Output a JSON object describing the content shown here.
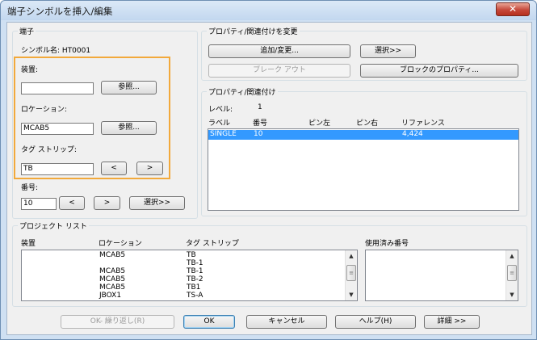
{
  "window": {
    "title": "端子シンボルを挿入/編集",
    "close_glyph": "✕"
  },
  "terminal": {
    "legend": "端子",
    "symbol_name_label": "シンボル名: HT0001",
    "device_label": "装置:",
    "device_value": "",
    "browse_label": "参照...",
    "location_label": "ロケーション:",
    "location_value": "MCAB5",
    "strip_label": "タグ ストリップ:",
    "strip_value": "TB",
    "prev_label": "<",
    "next_label": ">",
    "number_label": "番号:",
    "number_value": "10",
    "select_label": "選択>>"
  },
  "props_change": {
    "legend": "プロパティ/関連付けを変更",
    "add_change_label": "追加/変更...",
    "select_label": "選択>>",
    "break_out_label": "ブレーク アウト",
    "block_props_label": "ブロックのプロパティ..."
  },
  "props_assoc": {
    "legend": "プロパティ/関連付け",
    "level_label": "レベル:",
    "level_value": "1",
    "columns": [
      "ラベル",
      "番号",
      "ピン左",
      "ピン右",
      "リファレンス"
    ],
    "rows": [
      {
        "label": "SINGLE",
        "number": "10",
        "pin_left": "",
        "pin_right": "",
        "reference": "4,424"
      }
    ]
  },
  "project_list": {
    "legend": "プロジェクト リスト",
    "columns": [
      "装置",
      "ロケーション",
      "タグ ストリップ"
    ],
    "rows": [
      {
        "device": "",
        "location": "MCAB5",
        "strip": "TB"
      },
      {
        "device": "",
        "location": "",
        "strip": "TB-1"
      },
      {
        "device": "",
        "location": "MCAB5",
        "strip": "TB-1"
      },
      {
        "device": "",
        "location": "MCAB5",
        "strip": "TB-2"
      },
      {
        "device": "",
        "location": "MCAB5",
        "strip": "TB1"
      },
      {
        "device": "",
        "location": "JBOX1",
        "strip": "TS-A"
      }
    ],
    "used_numbers_label": "使用済み番号",
    "used_numbers": []
  },
  "footer": {
    "ok_repeat_label": "OK- 繰り返し(R)",
    "ok_label": "OK",
    "cancel_label": "キャンセル",
    "help_label": "ヘルプ(H)",
    "details_label": "詳細 >>"
  },
  "colors": {
    "selection": "#3399ff",
    "highlight_frame": "#f2a93b",
    "close_button": "#c6483a"
  }
}
